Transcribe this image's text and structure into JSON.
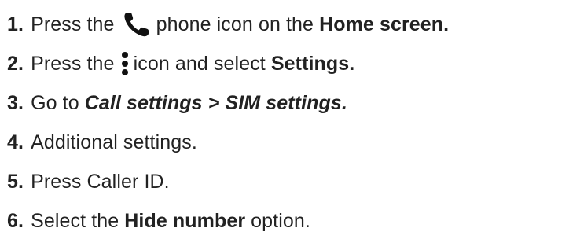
{
  "steps": [
    {
      "number": "1.",
      "text_a": "Press the",
      "icon": "phone-icon",
      "text_b": "phone icon on the",
      "text_bold": "Home screen."
    },
    {
      "number": "2.",
      "text_a": "Press the",
      "icon": "more-vertical-icon",
      "text_b": "icon and select",
      "text_bold": "Settings."
    },
    {
      "number": "3.",
      "text_a": "Go to",
      "text_italic": "Call settings > SIM settings."
    },
    {
      "number": "4.",
      "text_a": "Additional settings."
    },
    {
      "number": "5.",
      "text_a": "Press Caller ID."
    },
    {
      "number": "6.",
      "text_a": "Select the",
      "text_bold": "Hide number",
      "text_c": "option."
    }
  ],
  "colors": {
    "text": "#222222",
    "icon": "#111111"
  }
}
